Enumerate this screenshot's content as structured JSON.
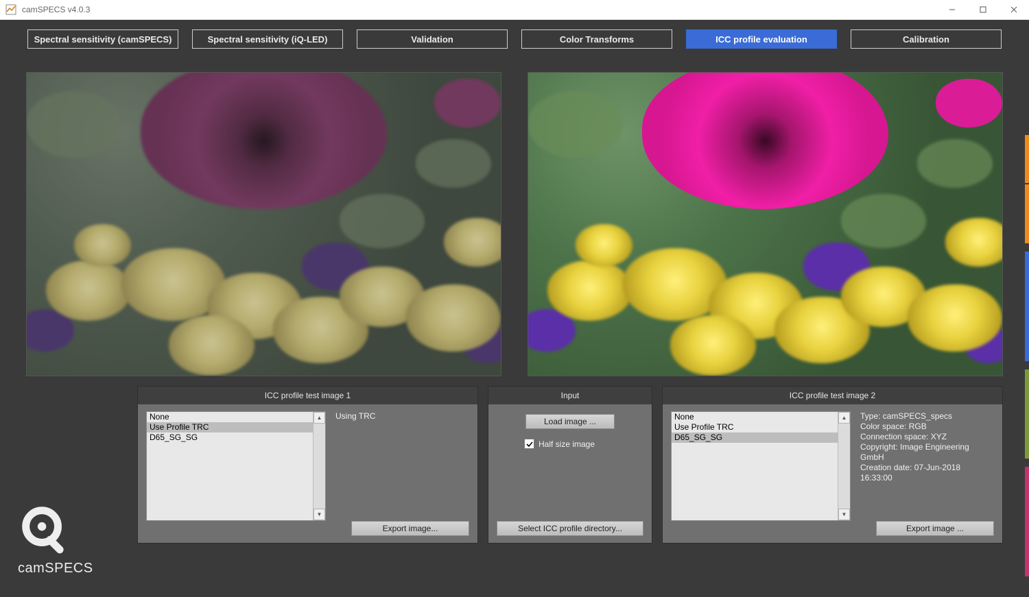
{
  "window": {
    "title": "camSPECS v4.0.3"
  },
  "tabs": {
    "t0": "Spectral sensitivity (camSPECS)",
    "t1": "Spectral sensitivity (iQ-LED)",
    "t2": "Validation",
    "t3": "Color Transforms",
    "t4": "ICC profile evaluation",
    "t5": "Calibration"
  },
  "panels": {
    "left_title": "ICC profile test image 1",
    "mid_title": "Input",
    "right_title": "ICC profile test image 2"
  },
  "left": {
    "options": [
      "None",
      "Use Profile TRC",
      "D65_SG_SG"
    ],
    "selected": "Use Profile TRC",
    "status": "Using TRC",
    "export_label": "Export image..."
  },
  "right": {
    "options": [
      "None",
      "Use Profile TRC",
      "D65_SG_SG"
    ],
    "selected": "D65_SG_SG",
    "export_label": "Export image ...",
    "info_line1": "Type: camSPECS_specs",
    "info_line2": "Color space: RGB",
    "info_line3": "Connection space: XYZ",
    "info_line4": "Copyright: Image Engineering GmbH",
    "info_line5": "Creation date: 07-Jun-2018 16:33:00"
  },
  "input": {
    "load_label": "Load image ...",
    "half_label": "Half size image",
    "half_checked": true,
    "select_dir_label": "Select ICC profile directory..."
  },
  "brand": {
    "name": "camSPECS"
  }
}
